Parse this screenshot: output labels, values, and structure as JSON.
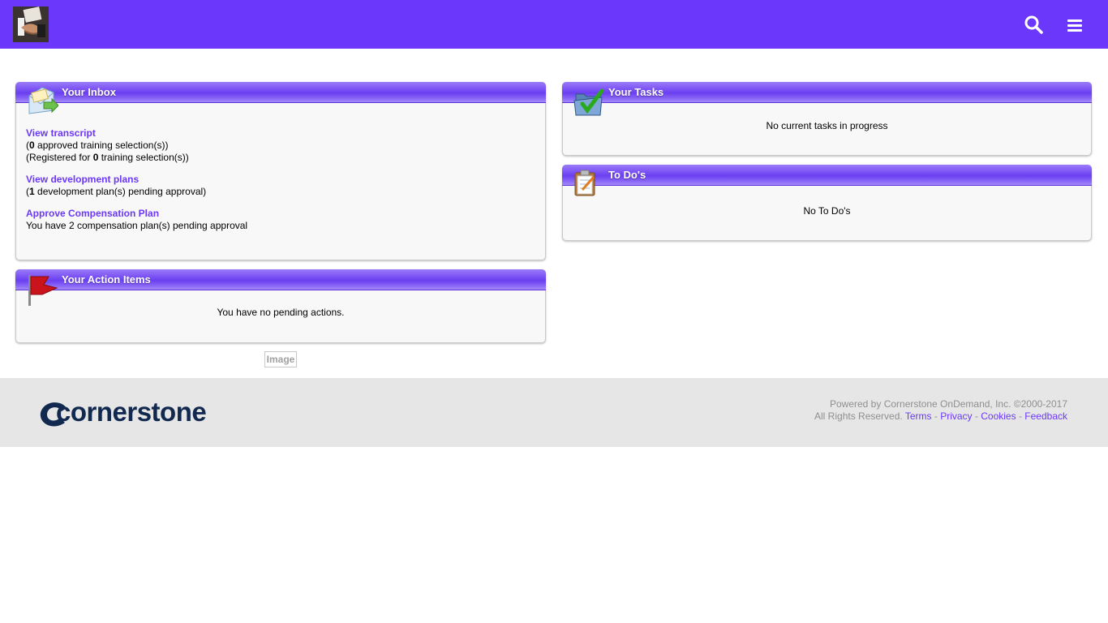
{
  "header": {
    "logo_icon": "handshake-avatar-icon",
    "search_icon": "search-icon",
    "menu_icon": "hamburger-menu-icon",
    "brand_color": "#6b38fb"
  },
  "inbox": {
    "title": "Your Inbox",
    "icon": "mail-inbox-icon",
    "transcript": {
      "link": "View transcript",
      "line1_open": "(",
      "line1_count": "0",
      "line1_text": " approved training selection(s))",
      "line2_text": "(Registered for ",
      "line2_count": "0",
      "line2_rest": " training selection(s))"
    },
    "dev_plans": {
      "link": "View development plans",
      "line_open": "(",
      "line_count": "1",
      "line_text": " development plan(s) pending approval)"
    },
    "compensation": {
      "link": "Approve Compensation Plan",
      "line_text": "You have 2 compensation plan(s) pending approval"
    }
  },
  "action_items": {
    "title": "Your Action Items",
    "icon": "red-flag-icon",
    "message": "You have no pending actions."
  },
  "image_placeholder": "Image",
  "tasks": {
    "title": "Your Tasks",
    "icon": "folder-check-icon",
    "message": "No current tasks in progress"
  },
  "todos": {
    "title": "To Do's",
    "icon": "clipboard-checklist-icon",
    "message": "No To Do's"
  },
  "footer": {
    "brand": "cornerstone",
    "powered_by": "Powered by Cornerstone OnDemand, Inc. ©2000-2017",
    "rights": "All Rights Reserved.",
    "links": {
      "terms": "Terms",
      "privacy": "Privacy",
      "cookies": "Cookies",
      "feedback": "Feedback"
    },
    "separator": "-"
  }
}
